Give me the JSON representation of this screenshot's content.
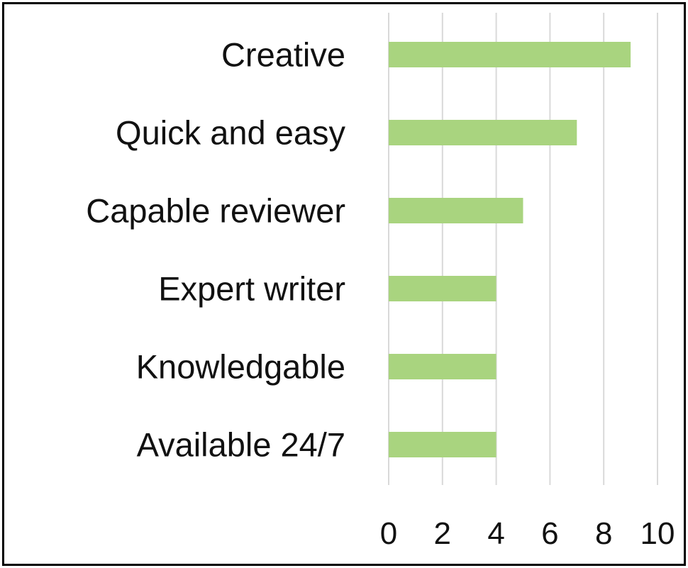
{
  "chart_data": {
    "type": "bar",
    "orientation": "horizontal",
    "title": "",
    "xlabel": "",
    "ylabel": "",
    "categories": [
      "Creative",
      "Quick and easy",
      "Capable reviewer",
      "Expert writer",
      "Knowledgable",
      "Available 24/7"
    ],
    "values": [
      9,
      7,
      5,
      4,
      4,
      4
    ],
    "xlim": [
      0,
      10
    ],
    "x_ticks": [
      "0",
      "2",
      "4",
      "6",
      "8",
      "10"
    ],
    "grid": "vertical",
    "legend": "none",
    "bar_color": "#a9d47f",
    "grid_color": "#d9d9d9"
  }
}
